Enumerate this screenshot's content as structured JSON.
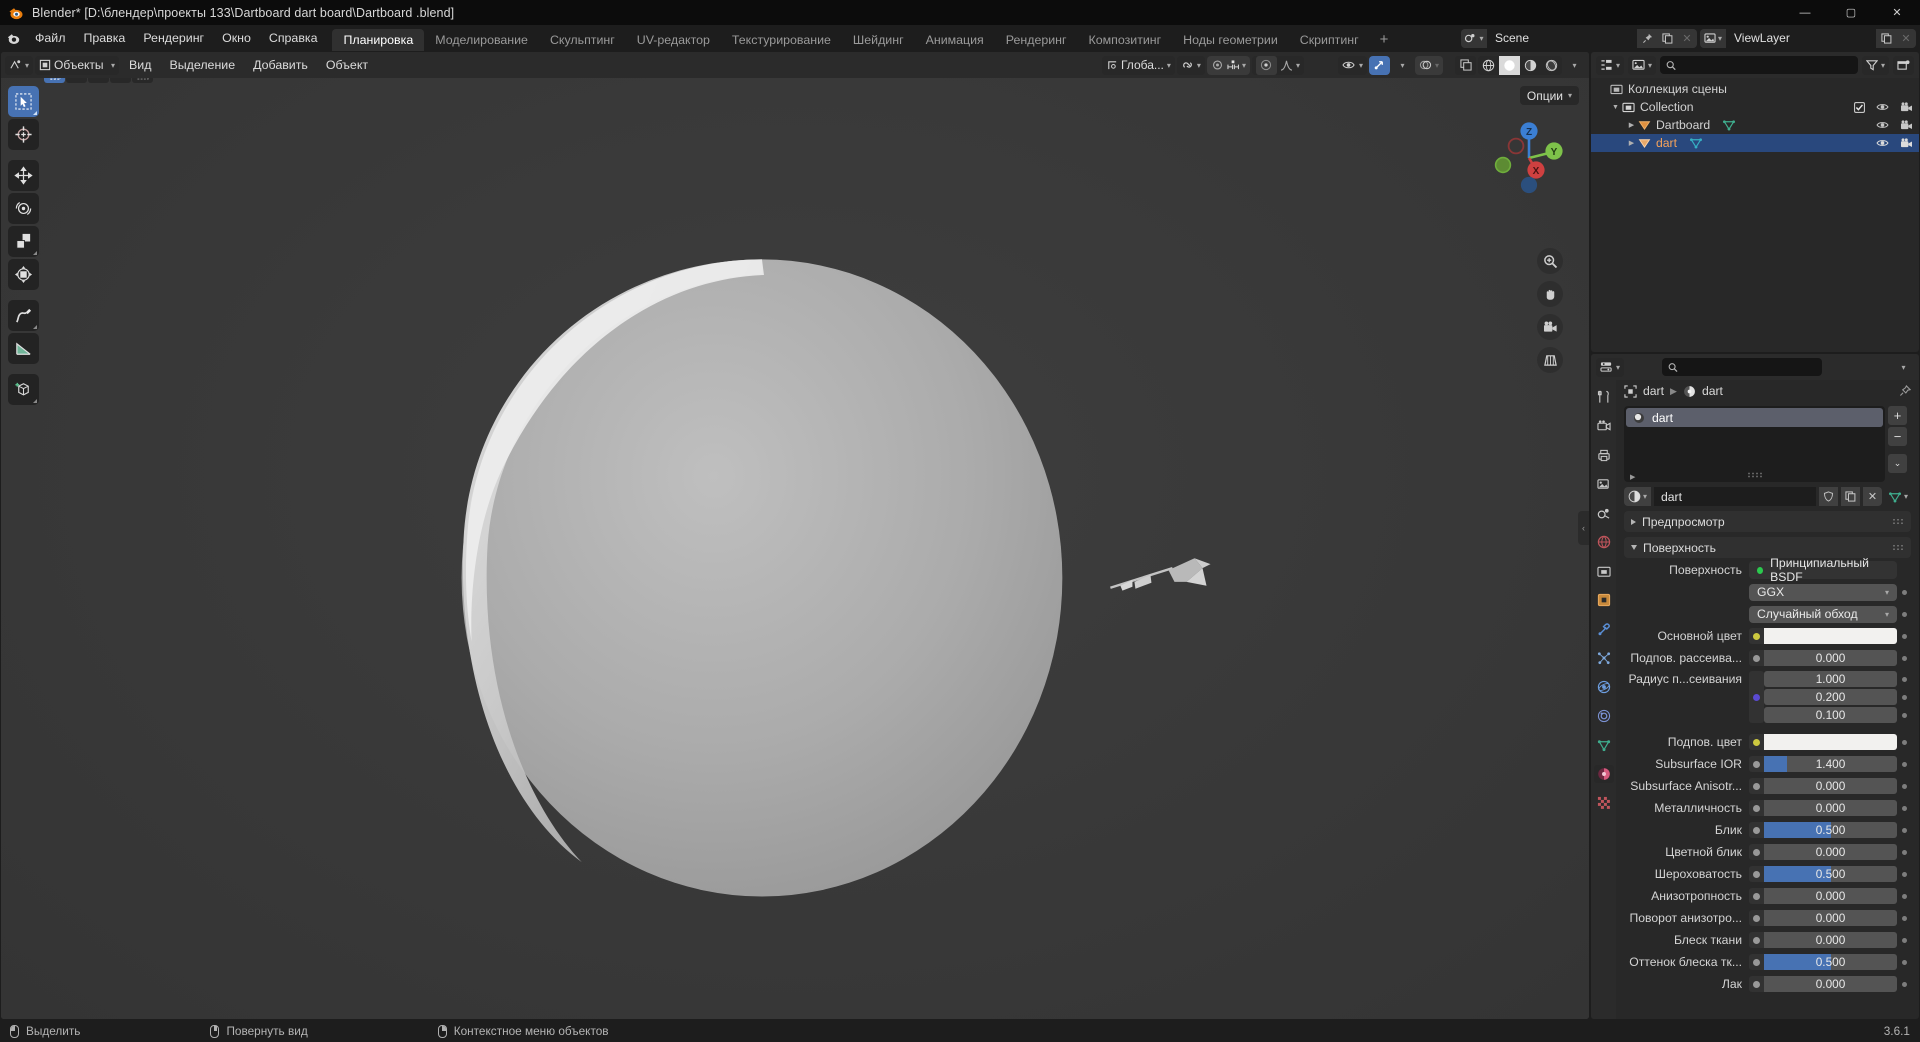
{
  "window": {
    "title": "Blender* [D:\\блендер\\проекты 133\\Dartboard dart board\\Dartboard .blend]",
    "minimize": "—",
    "maximize": "▢",
    "close": "✕"
  },
  "topbar": {
    "menus": [
      "Файл",
      "Правка",
      "Рендеринг",
      "Окно",
      "Справка"
    ],
    "workspace_tabs": [
      {
        "label": "Планировка",
        "active": true
      },
      {
        "label": "Моделирование",
        "active": false
      },
      {
        "label": "Скульптинг",
        "active": false
      },
      {
        "label": "UV-редактор",
        "active": false
      },
      {
        "label": "Текстурирование",
        "active": false
      },
      {
        "label": "Шейдинг",
        "active": false
      },
      {
        "label": "Анимация",
        "active": false
      },
      {
        "label": "Рендеринг",
        "active": false
      },
      {
        "label": "Композитинг",
        "active": false
      },
      {
        "label": "Ноды геометрии",
        "active": false
      },
      {
        "label": "Скриптинг",
        "active": false
      }
    ],
    "add_workspace": "+",
    "scene_name": "Scene",
    "viewlayer_name": "ViewLayer"
  },
  "viewport": {
    "mode": "Объекты",
    "menus": [
      "Вид",
      "Выделение",
      "Добавить",
      "Объект"
    ],
    "transform_orientation": "Глоба...",
    "options_label": "Опции",
    "gizmo_axes": {
      "x": "X",
      "y": "Y",
      "z": "Z"
    },
    "tools": [
      {
        "name": "tweak-tool",
        "active": true
      },
      {
        "name": "cursor-tool",
        "active": false
      },
      {
        "name": "move-tool",
        "active": false
      },
      {
        "name": "rotate-tool",
        "active": false
      },
      {
        "name": "scale-tool",
        "active": false
      },
      {
        "name": "transform-tool",
        "active": false
      },
      {
        "name": "annotate-tool",
        "active": false
      },
      {
        "name": "measure-tool",
        "active": false
      },
      {
        "name": "add-cube-tool",
        "active": false
      }
    ]
  },
  "outliner": {
    "search_placeholder": "",
    "rows": [
      {
        "label": "Коллекция сцены",
        "depth": 0,
        "icon": "collection-icon",
        "selected": false,
        "expandable": false,
        "has_toggles": false
      },
      {
        "label": "Collection",
        "depth": 1,
        "icon": "collection-icon",
        "selected": false,
        "expandable": true,
        "has_toggles": true,
        "checkbox": true
      },
      {
        "label": "Dartboard",
        "depth": 2,
        "icon": "object-mesh-icon",
        "selected": false,
        "expandable": true,
        "has_toggles": true,
        "mesh_color": "#3fae8e"
      },
      {
        "label": "dart",
        "depth": 2,
        "icon": "object-mesh-icon",
        "selected": true,
        "expandable": true,
        "has_toggles": true,
        "mesh_color": "#36b0c4"
      }
    ]
  },
  "properties": {
    "search_placeholder": "",
    "breadcrumb": {
      "object": "dart",
      "material": "dart"
    },
    "material_slot": "dart",
    "material_name": "dart",
    "slot_buttons": {
      "add": "+",
      "remove": "−",
      "menu": "⌄"
    },
    "panels": [
      {
        "key": "preview",
        "label": "Предпросмотр",
        "open": false
      },
      {
        "key": "surface",
        "label": "Поверхность",
        "open": true
      }
    ],
    "surface": {
      "shader_label": "Поверхность",
      "shader_value": "Принципиальный BSDF",
      "distribution": "GGX",
      "subsurface_method": "Случайный обход"
    },
    "rows": [
      {
        "label": "Основной цвет",
        "type": "color",
        "value": "#f2f1ef",
        "socket": "#ccc83f"
      },
      {
        "label": "Подпов. рассеива...",
        "type": "value",
        "value": "0.000",
        "fill": 0,
        "socket": "#999999"
      },
      {
        "label": "Радиус п...сеивания",
        "type": "vector",
        "values": [
          "1.000",
          "0.200",
          "0.100"
        ],
        "socket": "#5a4ad1"
      },
      {
        "label": "Подпов. цвет",
        "type": "color",
        "value": "#f2f1ef",
        "socket": "#ccc83f"
      },
      {
        "label": "Subsurface IOR",
        "type": "value",
        "value": "1.400",
        "fill": 17,
        "socket": "#999999"
      },
      {
        "label": "Subsurface Anisotr...",
        "type": "value",
        "value": "0.000",
        "fill": 0,
        "socket": "#999999"
      },
      {
        "label": "Металличность",
        "type": "value",
        "value": "0.000",
        "fill": 0,
        "socket": "#999999"
      },
      {
        "label": "Блик",
        "type": "value",
        "value": "0.500",
        "fill": 50,
        "socket": "#999999"
      },
      {
        "label": "Цветной блик",
        "type": "value",
        "value": "0.000",
        "fill": 0,
        "socket": "#999999"
      },
      {
        "label": "Шероховатость",
        "type": "value",
        "value": "0.500",
        "fill": 50,
        "socket": "#999999"
      },
      {
        "label": "Анизотропность",
        "type": "value",
        "value": "0.000",
        "fill": 0,
        "socket": "#999999"
      },
      {
        "label": "Поворот анизотро...",
        "type": "value",
        "value": "0.000",
        "fill": 0,
        "socket": "#999999"
      },
      {
        "label": "Блеск ткани",
        "type": "value",
        "value": "0.000",
        "fill": 0,
        "socket": "#999999"
      },
      {
        "label": "Оттенок блеска тк...",
        "type": "value",
        "value": "0.500",
        "fill": 50,
        "socket": "#999999"
      },
      {
        "label": "Лак",
        "type": "value",
        "value": "0.000",
        "fill": 0,
        "socket": "#999999"
      }
    ]
  },
  "statusbar": {
    "items": [
      {
        "mouse": "left",
        "label": "Выделить"
      },
      {
        "mouse": "middle",
        "label": "Повернуть вид"
      },
      {
        "mouse": "right",
        "label": "Контекстное меню объектов"
      }
    ],
    "version": "3.6.1"
  }
}
